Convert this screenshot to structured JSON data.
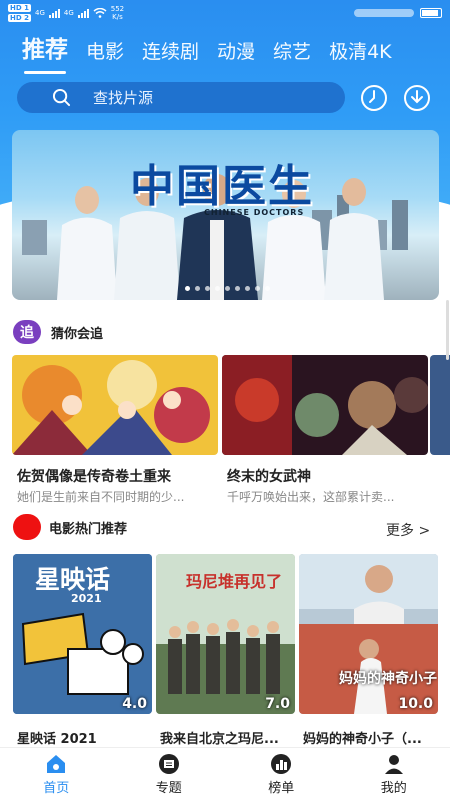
{
  "status": {
    "sim1": "HD 1",
    "sim2": "HD 2",
    "net1": "4G",
    "net2": "4G",
    "speed_value": "552",
    "speed_unit": "K/s"
  },
  "tabs": [
    {
      "label": "推荐",
      "active": true
    },
    {
      "label": "电影"
    },
    {
      "label": "连续剧"
    },
    {
      "label": "动漫"
    },
    {
      "label": "综艺"
    },
    {
      "label": "极清4K"
    }
  ],
  "search": {
    "placeholder": "查找片源"
  },
  "banner": {
    "title": "中国医生",
    "subtitle": "CHINESE DOCTORS",
    "dot_count": 9,
    "active_dot": 0
  },
  "section_follow": {
    "badge": "追",
    "title": "猜你会追",
    "cards": [
      {
        "title": "佐贺偶像是传奇卷土重来",
        "desc": "她们是生前来自不同时期的少..."
      },
      {
        "title": "终末的女武神",
        "desc": "千呼万唤始出来，这部累计卖..."
      }
    ]
  },
  "section_hot": {
    "title": "电影热门推荐",
    "more": "更多 >",
    "items": [
      {
        "title": "星映话 2021",
        "score": "4.0",
        "poster_text": "星映话",
        "poster_year": "2021"
      },
      {
        "title": "我来自北京之玛尼...",
        "score": "7.0",
        "poster_text": "玛尼堆再见了"
      },
      {
        "title": "妈妈的神奇小子（...",
        "score": "10.0",
        "poster_text": "妈妈的神奇小子"
      }
    ]
  },
  "bottom_nav": [
    {
      "label": "首页",
      "icon": "home-icon",
      "active": true
    },
    {
      "label": "专题",
      "icon": "topic-icon"
    },
    {
      "label": "榜单",
      "icon": "ranking-icon"
    },
    {
      "label": "我的",
      "icon": "profile-icon"
    }
  ],
  "colors": {
    "accent": "#2a8ef0",
    "hot": "#ee1111",
    "badge": "#7a3fbf"
  }
}
